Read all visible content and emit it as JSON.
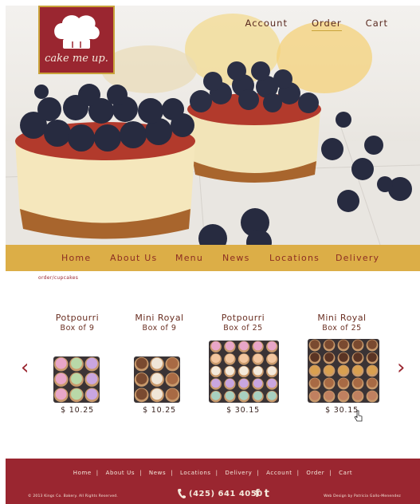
{
  "brand": {
    "logo_text": "cake me up."
  },
  "top_nav": [
    {
      "label": "Account"
    },
    {
      "label": "Order"
    },
    {
      "label": "Cart"
    }
  ],
  "main_nav": [
    {
      "label": "Home"
    },
    {
      "label": "About Us"
    },
    {
      "label": "Menu"
    },
    {
      "label": "News"
    },
    {
      "label": "Locations"
    },
    {
      "label": "Delivery"
    }
  ],
  "breadcrumb": "order/cupcakes",
  "products": [
    {
      "name": "Potpourri",
      "size": "Box of 9",
      "price": "$ 10.25"
    },
    {
      "name": "Mini Royal",
      "size": "Box of 9",
      "price": "$ 10.25"
    },
    {
      "name": "Potpourri",
      "size": "Box of 25",
      "price": "$ 30.15"
    },
    {
      "name": "Mini Royal",
      "size": "Box of 25",
      "price": "$ 30.15"
    }
  ],
  "arrows": {
    "prev": "‹",
    "next": "›"
  },
  "footer": {
    "links": [
      "Home",
      "About Us",
      "News",
      "Locations",
      "Delivery",
      "Account",
      "Order",
      "Cart"
    ],
    "separator": "|",
    "copyright": "© 2013 Kings Co. Bakery. All Rights Reserved.",
    "phone": "(425) 641 4050",
    "social": [
      "f",
      "t"
    ],
    "credit": "Web Design by Patricia Gallo-Menendez"
  },
  "colors": {
    "brand_red": "#9a2630",
    "nav_gold": "#dcae47",
    "nav_text": "#8c2d23"
  }
}
